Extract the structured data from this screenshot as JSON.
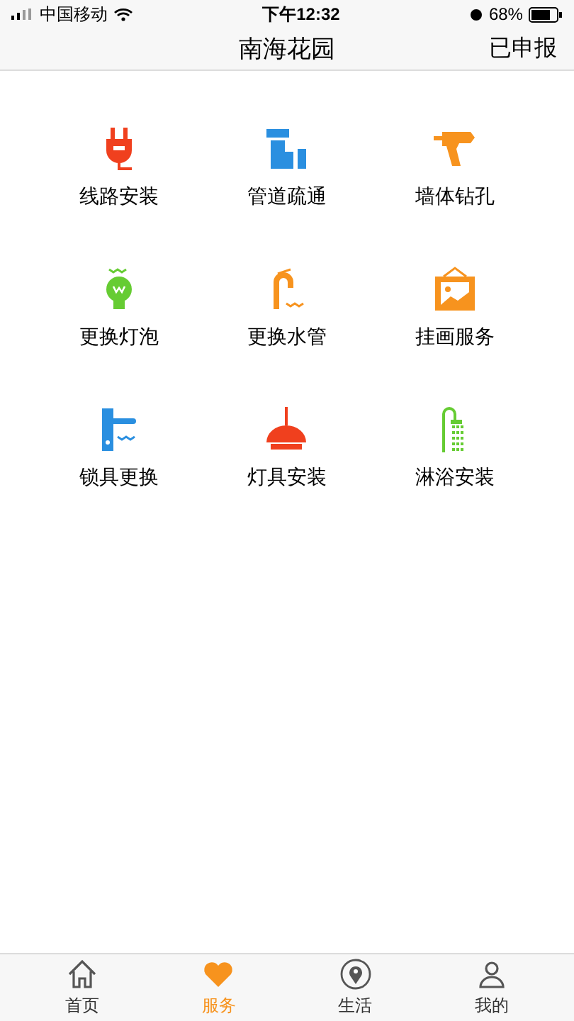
{
  "status_bar": {
    "carrier": "中国移动",
    "time": "下午12:32",
    "battery": "68%"
  },
  "nav": {
    "title": "南海花园",
    "action": "已申报"
  },
  "services": [
    {
      "label": "线路安装",
      "kind": "plug"
    },
    {
      "label": "管道疏通",
      "kind": "pipe"
    },
    {
      "label": "墙体钻孔",
      "kind": "drill"
    },
    {
      "label": "更换灯泡",
      "kind": "bulb"
    },
    {
      "label": "更换水管",
      "kind": "faucet"
    },
    {
      "label": "挂画服务",
      "kind": "frame"
    },
    {
      "label": "锁具更换",
      "kind": "lock"
    },
    {
      "label": "灯具安装",
      "kind": "lamp"
    },
    {
      "label": "淋浴安装",
      "kind": "shower"
    }
  ],
  "tabs": [
    {
      "label": "首页",
      "kind": "home",
      "selected": false
    },
    {
      "label": "服务",
      "kind": "heart",
      "selected": true
    },
    {
      "label": "生活",
      "kind": "pin",
      "selected": false
    },
    {
      "label": "我的",
      "kind": "person",
      "selected": false
    }
  ]
}
